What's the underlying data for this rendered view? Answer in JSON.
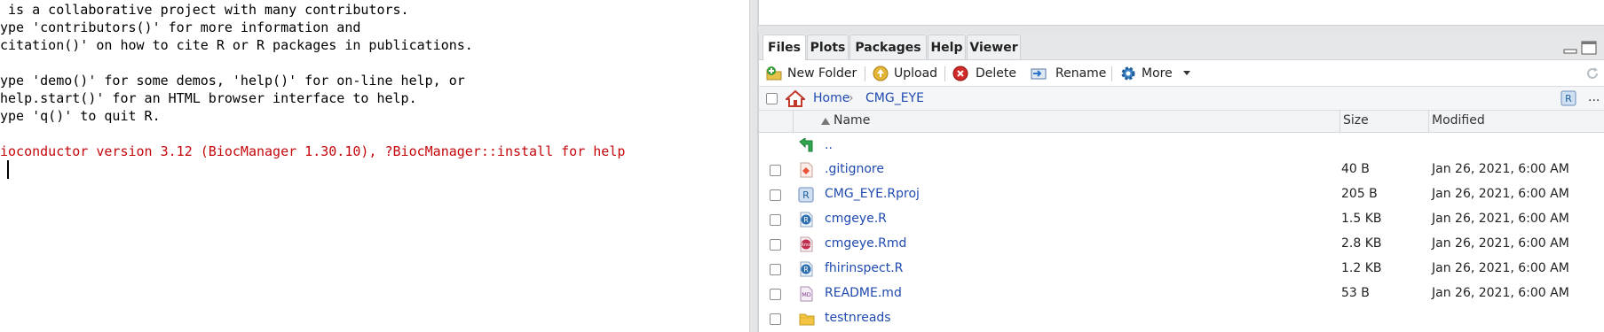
{
  "console": {
    "lines": [
      " is a collaborative project with many contributors.",
      "ype 'contributors()' for more information and",
      "citation()' on how to cite R or R packages in publications.",
      "",
      "ype 'demo()' for some demos, 'help()' for on-line help, or",
      "help.start()' for an HTML browser interface to help.",
      "ype 'q()' to quit R.",
      "",
      "ioconductor version 3.12 (BiocManager 1.30.10), ?BiocManager::install for help"
    ],
    "message_color": "#c5060b"
  },
  "tabs": [
    "Files",
    "Plots",
    "Packages",
    "Help",
    "Viewer"
  ],
  "active_tab": "Files",
  "toolbar": {
    "new_folder": "New Folder",
    "upload": "Upload",
    "delete": "Delete",
    "rename": "Rename",
    "more": "More"
  },
  "path": {
    "home": "Home",
    "separator": "›",
    "folder": "CMG_EYE",
    "overflow": "..."
  },
  "columns": {
    "name": "Name",
    "size": "Size",
    "modified": "Modified"
  },
  "files": {
    "parent": {
      "name": "..",
      "icon": "up-arrow-icon"
    },
    "rows": [
      {
        "name": ".gitignore",
        "size": "40 B",
        "modified": "Jan 26, 2021, 6:00 AM",
        "icon": "gitignore-file-icon"
      },
      {
        "name": "CMG_EYE.Rproj",
        "size": "205 B",
        "modified": "Jan 26, 2021, 6:00 AM",
        "icon": "rproj-file-icon"
      },
      {
        "name": "cmgeye.R",
        "size": "1.5 KB",
        "modified": "Jan 26, 2021, 6:00 AM",
        "icon": "r-file-icon"
      },
      {
        "name": "cmgeye.Rmd",
        "size": "2.8 KB",
        "modified": "Jan 26, 2021, 6:00 AM",
        "icon": "rmd-file-icon"
      },
      {
        "name": "fhirinspect.R",
        "size": "1.2 KB",
        "modified": "Jan 26, 2021, 6:00 AM",
        "icon": "r-file-icon"
      },
      {
        "name": "README.md",
        "size": "53 B",
        "modified": "Jan 26, 2021, 6:00 AM",
        "icon": "md-file-icon"
      },
      {
        "name": "testnreads",
        "size": "",
        "modified": "",
        "icon": "folder-icon"
      }
    ]
  },
  "icons": {
    "md_text": "MD",
    "rmd_text": "Rmd",
    "r_text": "R"
  },
  "colors": {
    "link": "#1f4ab0",
    "tab_bg": "#e6e7e9",
    "splitter": "#e4e5e7"
  }
}
